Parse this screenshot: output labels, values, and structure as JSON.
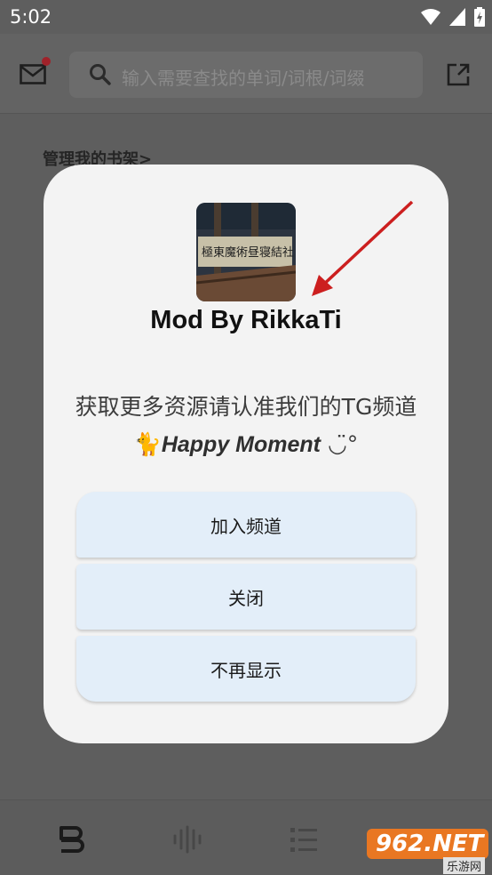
{
  "status_bar": {
    "time": "5:02"
  },
  "header": {
    "search_placeholder": "输入需要查找的单词/词根/词缀"
  },
  "main": {
    "shelf_link": "管理我的书架>"
  },
  "dialog": {
    "title": "Mod By RikkaTi",
    "message_part1": "获取更多资源请认准我们的TG频道",
    "emoji": "🐈",
    "message_em": "Happy Moment",
    "message_tail": "◡̈°",
    "buttons": {
      "join": "加入频道",
      "close": "关闭",
      "never": "不再显示"
    }
  },
  "watermark": {
    "logo": "962.NET",
    "sub": "乐游网"
  },
  "colors": {
    "accent_red": "#cc1f1f",
    "button_bg": "#e3eef9"
  }
}
